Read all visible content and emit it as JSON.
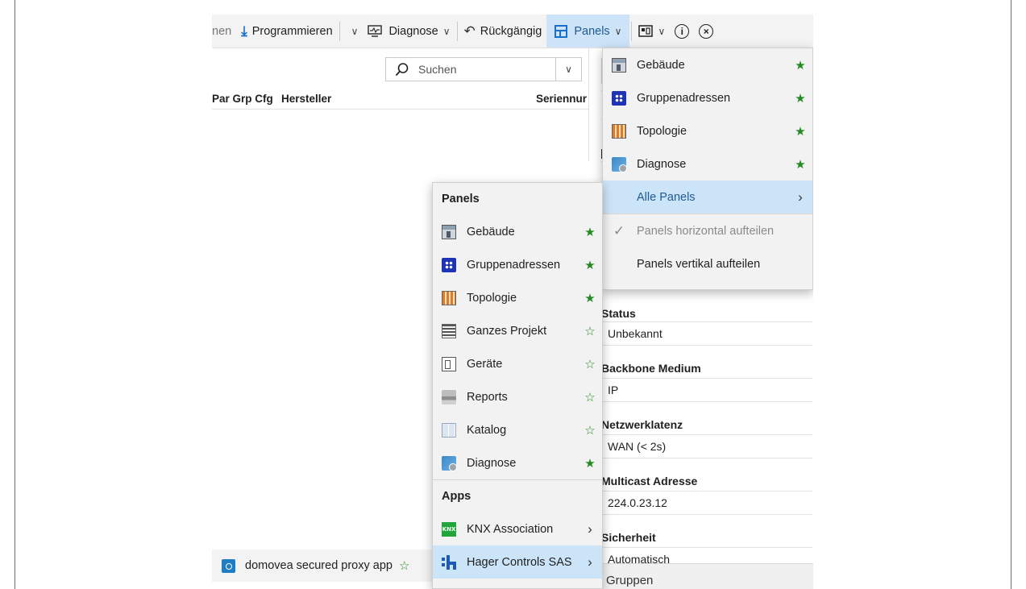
{
  "toolbar": {
    "cut_label": "nen",
    "program_label": "Programmieren",
    "diagnose_label": "Diagnose",
    "undo_label": "Rückgängig",
    "panels_label": "Panels"
  },
  "search": {
    "placeholder": "Suchen"
  },
  "table": {
    "columns": [
      "Par Grp Cfg",
      "Hersteller",
      "Seriennur"
    ]
  },
  "properties": [
    {
      "label": "Status",
      "value": "Unbekannt"
    },
    {
      "label": "Backbone Medium",
      "value": "IP"
    },
    {
      "label": "Netzwerklatenz",
      "value": "WAN (< 2s)"
    },
    {
      "label": "Multicast Adresse",
      "value": "224.0.23.12"
    },
    {
      "label": "Sicherheit",
      "value": "Automatisch"
    }
  ],
  "properties_display": [
    {
      "label": "Status",
      "value": "Unbekannt"
    },
    {
      "label": "Backbone Medium",
      "value": "IP"
    },
    {
      "label": "Netzwerklatenz",
      "value": "WAN (< 2s)"
    },
    {
      "label": "Multicast Adresse",
      "value": "224.0.23.12"
    },
    {
      "label": "Sicherheit",
      "value": "Automatisch"
    }
  ],
  "bottom_strip_label": "Gruppen",
  "status_app": {
    "label": "domovea secured proxy app"
  },
  "panels_dropdown": {
    "items": [
      {
        "label": "Gebäude",
        "icon": "building-icon",
        "favorite": true
      },
      {
        "label": "Gruppenadressen",
        "icon": "group-addresses-icon",
        "favorite": true
      },
      {
        "label": "Topologie",
        "icon": "topology-icon",
        "favorite": true
      },
      {
        "label": "Diagnose",
        "icon": "diagnostics-icon",
        "favorite": true
      }
    ],
    "all_panels_label": "Alle Panels",
    "split_horizontal_label": "Panels horizontal aufteilen",
    "split_vertical_label": "Panels vertikal aufteilen"
  },
  "all_panels_submenu": {
    "panels_header": "Panels",
    "panels": [
      {
        "label": "Gebäude",
        "icon": "building-icon",
        "favorite": true
      },
      {
        "label": "Gruppenadressen",
        "icon": "group-addresses-icon",
        "favorite": true
      },
      {
        "label": "Topologie",
        "icon": "topology-icon",
        "favorite": true
      },
      {
        "label": "Ganzes Projekt",
        "icon": "project-icon",
        "favorite": false
      },
      {
        "label": "Geräte",
        "icon": "devices-icon",
        "favorite": false
      },
      {
        "label": "Reports",
        "icon": "reports-icon",
        "favorite": false
      },
      {
        "label": "Katalog",
        "icon": "catalog-icon",
        "favorite": false
      },
      {
        "label": "Diagnose",
        "icon": "diagnostics-icon",
        "favorite": true
      }
    ],
    "apps_header": "Apps",
    "apps": [
      {
        "label": "KNX Association",
        "icon": "knx-icon"
      },
      {
        "label": "Hager Controls SAS",
        "icon": "hager-icon"
      }
    ]
  },
  "colors": {
    "accent": "#1a6fc9",
    "highlight": "#cce4f7",
    "favorite_star": "#218a21"
  }
}
